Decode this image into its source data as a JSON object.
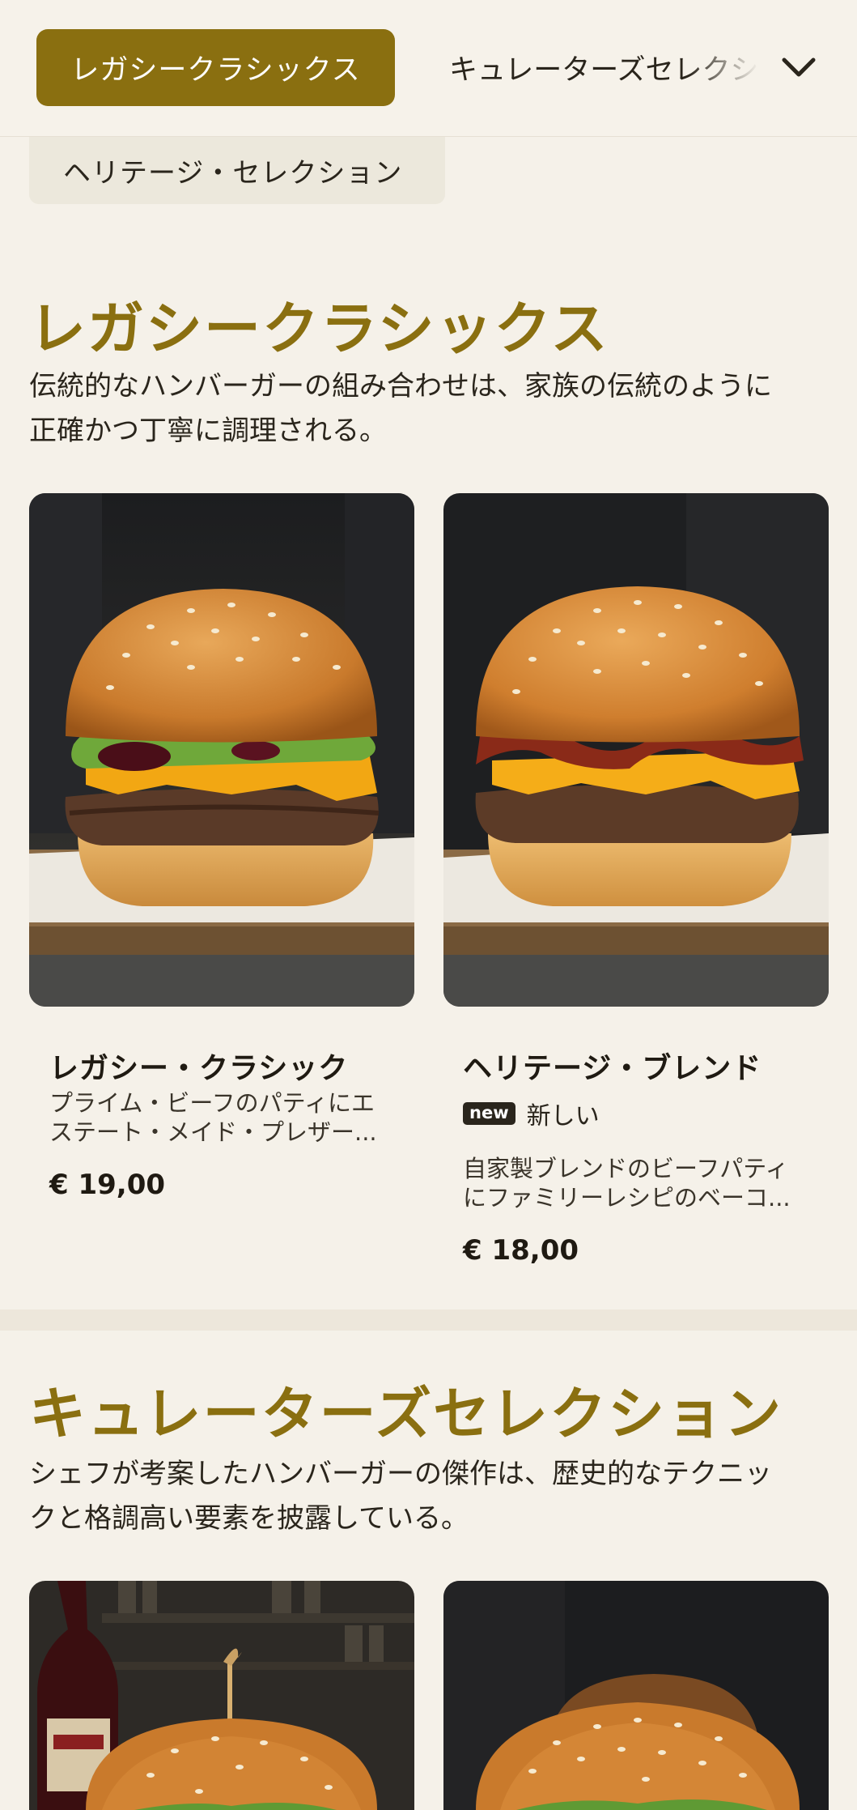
{
  "nav": {
    "active_tab": "レガシークラシックス",
    "next_tab": "キュレーターズセレクション",
    "overflow_tab": "ヘリテージ・セレクション",
    "dropdown_icon": "chevron-down-icon"
  },
  "sections": [
    {
      "title": "レガシークラシックス",
      "desc_line1": "伝統的なハンバーガーの組み合わせは、家族の伝統のように",
      "desc_line2": "正確かつ丁寧に調理される。",
      "products": [
        {
          "name": "レガシー・クラシック",
          "desc_line1": "プライム・ビーフのパティにエ",
          "desc_line2": "ステート・メイド・プレザー...",
          "price": "€ 19,00"
        },
        {
          "name": "ヘリテージ・ブレンド",
          "badge": "new",
          "badge_text": "新しい",
          "desc_line1": "自家製ブレンドのビーフパティ",
          "desc_line2": "にファミリーレシピのベーコ...",
          "price": "€ 18,00"
        }
      ]
    },
    {
      "title": "キュレーターズセレクション",
      "desc_line1": "シェフが考案したハンバーガーの傑作は、歴史的なテクニッ",
      "desc_line2": "クと格調高い要素を披露している。"
    }
  ],
  "colors": {
    "accent": "#8a6f10",
    "background": "#f5f1e9",
    "text": "#1f1a12"
  }
}
